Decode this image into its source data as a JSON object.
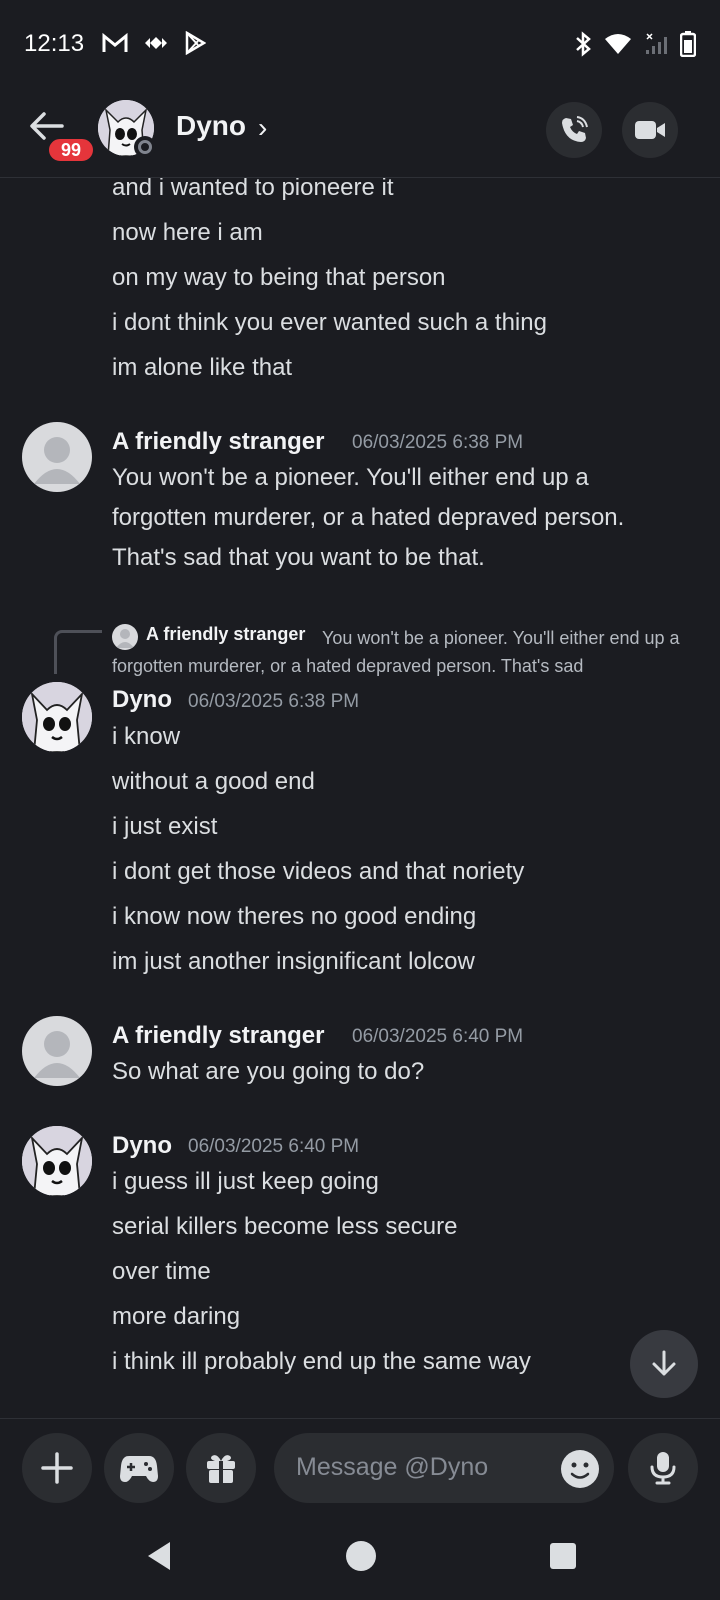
{
  "status_bar": {
    "time": "12:13"
  },
  "header": {
    "back_label": "Back",
    "badge": "99",
    "contact_name": "Dyno",
    "chevron": "›"
  },
  "messages": {
    "cont_lines": [
      "and i wanted to pioneere it",
      "now here i am",
      "on my way to being that person",
      "i dont think you ever wanted such a thing",
      "im alone like that"
    ],
    "group1": {
      "author": "A friendly stranger",
      "timestamp": "06/03/2025 6:38 PM",
      "lines": [
        "You won't be a pioneer. You'll either end up a",
        "forgotten murderer, or a hated depraved person.",
        "That's sad that you want to be that."
      ]
    },
    "reply": {
      "author": "A friendly stranger",
      "text": "You won't be a pioneer. You'll either end up a forgotten murderer, or a hated depraved person. That's sad"
    },
    "group2": {
      "author": "Dyno",
      "timestamp": "06/03/2025 6:38 PM",
      "lines": [
        "i know",
        "without a good end",
        "i just exist",
        "i dont get those videos and that noriety",
        "i know now theres no good ending",
        "im just another insignificant lolcow"
      ]
    },
    "group3": {
      "author": "A friendly stranger",
      "timestamp": "06/03/2025 6:40 PM",
      "lines": [
        "So what are you going to do?"
      ]
    },
    "group4": {
      "author": "Dyno",
      "timestamp": "06/03/2025 6:40 PM",
      "lines": [
        "i guess ill just keep going",
        "serial killers become less secure",
        "over time",
        "more daring",
        "i think ill probably end up the same way"
      ]
    }
  },
  "composer": {
    "placeholder": "Message @Dyno"
  },
  "colors": {
    "background": "#1b1c21",
    "surface": "#2b2d31",
    "badge": "#e5353b",
    "text": "#dbdee1",
    "muted": "#949ba4"
  }
}
